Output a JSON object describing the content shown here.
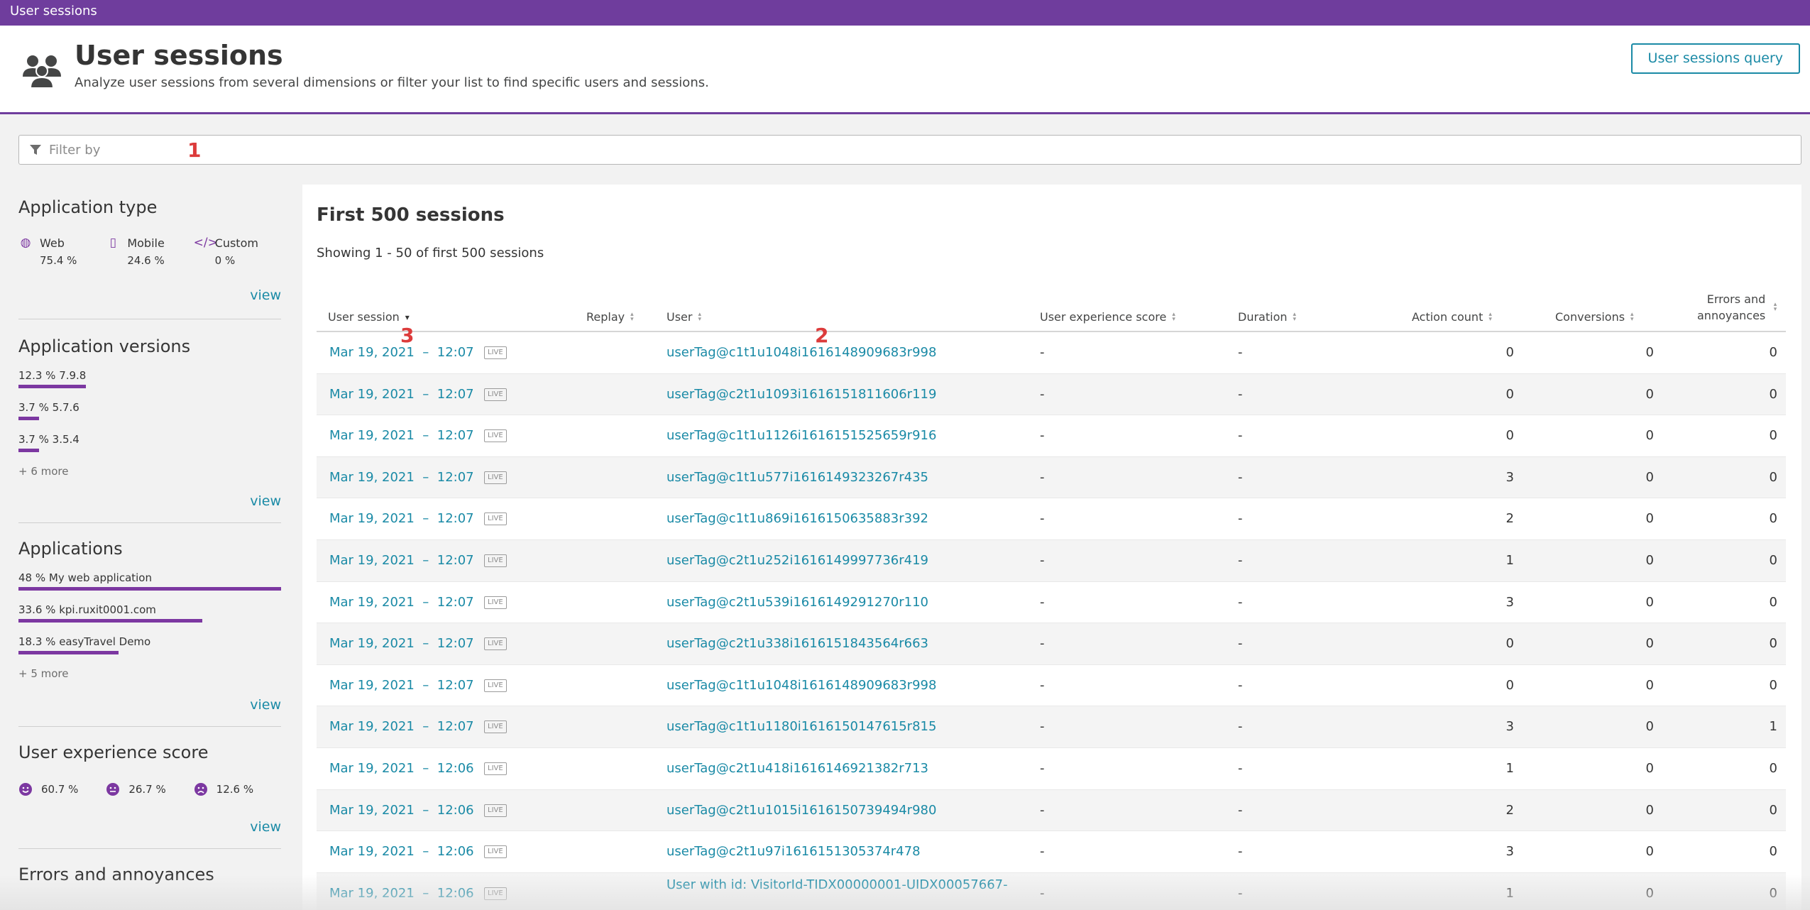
{
  "topbar": {
    "title": "User sessions"
  },
  "header": {
    "icon": "users-group-icon",
    "title": "User sessions",
    "subtitle": "Analyze user sessions from several dimensions or filter your list to find specific users and sessions.",
    "query_button": "User sessions query"
  },
  "filter": {
    "placeholder": "Filter by",
    "icon": "funnel-icon"
  },
  "markers": {
    "m1": "1",
    "m2": "2",
    "m3": "3"
  },
  "colors": {
    "accent": "#6f3d9d",
    "link": "#1a8aa6",
    "bar": "#7c38a1"
  },
  "sidebar": {
    "app_type": {
      "title": "Application type",
      "items": [
        {
          "label": "Web",
          "value": "75.4 %",
          "icon": "globe-icon"
        },
        {
          "label": "Mobile",
          "value": "24.6 %",
          "icon": "mobile-icon"
        },
        {
          "label": "Custom",
          "value": "0 %",
          "icon": "code-icon"
        }
      ],
      "view": "view"
    },
    "app_versions": {
      "title": "Application versions",
      "items": [
        {
          "label": "12.3 % 7.9.8",
          "share": 12.3
        },
        {
          "label": "3.7 % 5.7.6",
          "share": 3.7
        },
        {
          "label": "3.7 % 3.5.4",
          "share": 3.7
        }
      ],
      "more": "+ 6 more",
      "view": "view"
    },
    "applications": {
      "title": "Applications",
      "items": [
        {
          "label": "48 % My web application",
          "share": 48
        },
        {
          "label": "33.6 % kpi.ruxit0001.com",
          "share": 33.6
        },
        {
          "label": "18.3 % easyTravel Demo",
          "share": 18.3
        }
      ],
      "more": "+ 5 more",
      "view": "view"
    },
    "ux_score": {
      "title": "User experience score",
      "items": [
        {
          "value": "60.7 %",
          "icon": "satisfied-face-icon"
        },
        {
          "value": "26.7 %",
          "icon": "tolerating-face-icon"
        },
        {
          "value": "12.6 %",
          "icon": "frustrated-face-icon"
        }
      ],
      "view": "view"
    },
    "errors": {
      "title": "Errors and annoyances"
    }
  },
  "main": {
    "title": "First 500 sessions",
    "showing": "Showing 1 - 50 of first 500 sessions",
    "columns": {
      "user_session": "User session",
      "replay": "Replay",
      "user": "User",
      "ux": "User experience score",
      "duration": "Duration",
      "actions": "Action count",
      "conversions": "Conversions",
      "errors_line1": "Errors and",
      "errors_line2": "annoyances"
    },
    "live_label": "LIVE",
    "rows": [
      {
        "date": "Mar 19, 2021",
        "sep": "–",
        "time": "12:07",
        "user": "userTag@c1t1u1048i1616148909683r998",
        "ux": "-",
        "duration": "-",
        "actions": "0",
        "conversions": "0",
        "errors": "0"
      },
      {
        "date": "Mar 19, 2021",
        "sep": "–",
        "time": "12:07",
        "user": "userTag@c2t1u1093i1616151811606r119",
        "ux": "-",
        "duration": "-",
        "actions": "0",
        "conversions": "0",
        "errors": "0"
      },
      {
        "date": "Mar 19, 2021",
        "sep": "–",
        "time": "12:07",
        "user": "userTag@c1t1u1126i1616151525659r916",
        "ux": "-",
        "duration": "-",
        "actions": "0",
        "conversions": "0",
        "errors": "0"
      },
      {
        "date": "Mar 19, 2021",
        "sep": "–",
        "time": "12:07",
        "user": "userTag@c1t1u577i1616149323267r435",
        "ux": "-",
        "duration": "-",
        "actions": "3",
        "conversions": "0",
        "errors": "0"
      },
      {
        "date": "Mar 19, 2021",
        "sep": "–",
        "time": "12:07",
        "user": "userTag@c1t1u869i1616150635883r392",
        "ux": "-",
        "duration": "-",
        "actions": "2",
        "conversions": "0",
        "errors": "0"
      },
      {
        "date": "Mar 19, 2021",
        "sep": "–",
        "time": "12:07",
        "user": "userTag@c2t1u252i1616149997736r419",
        "ux": "-",
        "duration": "-",
        "actions": "1",
        "conversions": "0",
        "errors": "0"
      },
      {
        "date": "Mar 19, 2021",
        "sep": "–",
        "time": "12:07",
        "user": "userTag@c2t1u539i1616149291270r110",
        "ux": "-",
        "duration": "-",
        "actions": "3",
        "conversions": "0",
        "errors": "0"
      },
      {
        "date": "Mar 19, 2021",
        "sep": "–",
        "time": "12:07",
        "user": "userTag@c2t1u338i1616151843564r663",
        "ux": "-",
        "duration": "-",
        "actions": "0",
        "conversions": "0",
        "errors": "0"
      },
      {
        "date": "Mar 19, 2021",
        "sep": "–",
        "time": "12:07",
        "user": "userTag@c1t1u1048i1616148909683r998",
        "ux": "-",
        "duration": "-",
        "actions": "0",
        "conversions": "0",
        "errors": "0"
      },
      {
        "date": "Mar 19, 2021",
        "sep": "–",
        "time": "12:07",
        "user": "userTag@c1t1u1180i1616150147615r815",
        "ux": "-",
        "duration": "-",
        "actions": "3",
        "conversions": "0",
        "errors": "1"
      },
      {
        "date": "Mar 19, 2021",
        "sep": "–",
        "time": "12:06",
        "user": "userTag@c2t1u418i1616146921382r713",
        "ux": "-",
        "duration": "-",
        "actions": "1",
        "conversions": "0",
        "errors": "0"
      },
      {
        "date": "Mar 19, 2021",
        "sep": "–",
        "time": "12:06",
        "user": "userTag@c2t1u1015i1616150739494r980",
        "ux": "-",
        "duration": "-",
        "actions": "2",
        "conversions": "0",
        "errors": "0"
      },
      {
        "date": "Mar 19, 2021",
        "sep": "–",
        "time": "12:06",
        "user": "userTag@c2t1u97i1616151305374r478",
        "ux": "-",
        "duration": "-",
        "actions": "3",
        "conversions": "0",
        "errors": "0"
      },
      {
        "date": "Mar 19, 2021",
        "sep": "–",
        "time": "12:06",
        "user": "User with id: VisitorId-TIDX00000001-UIDX00057667-",
        "ux": "-",
        "duration": "-",
        "actions": "1",
        "conversions": "0",
        "errors": "0"
      }
    ]
  }
}
